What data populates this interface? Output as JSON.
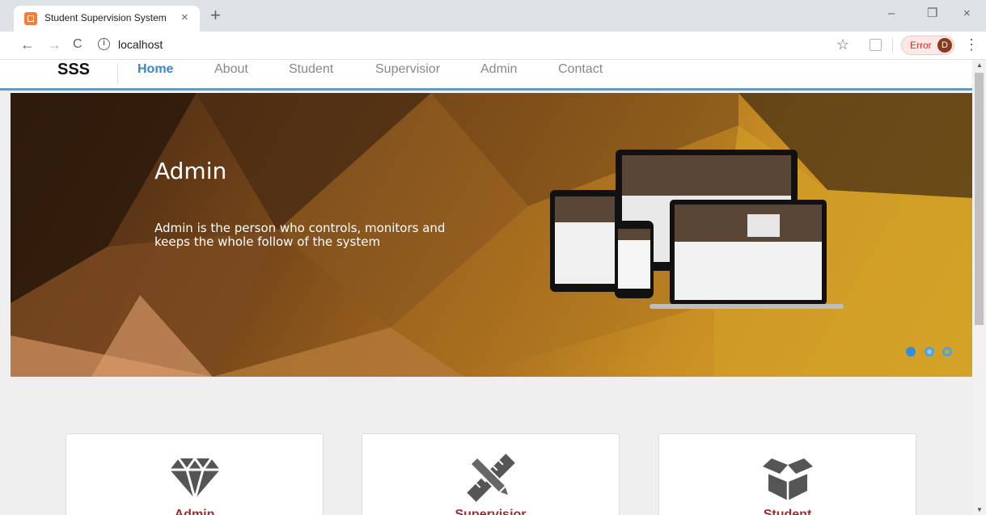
{
  "browser": {
    "tab_title": "Student Supervision System",
    "tab_close": "×",
    "new_tab": "+",
    "url": "localhost",
    "error_label": "Error",
    "profile_initial": "D",
    "window_controls": {
      "minimize": "–",
      "restore": "❐",
      "close": "×"
    },
    "nav": {
      "back": "←",
      "forward": "→",
      "reload": "C"
    },
    "info_glyph": "i",
    "star_glyph": "☆",
    "menu_glyph": "⋮"
  },
  "site": {
    "brand": "SSS",
    "nav": [
      {
        "label": "Home",
        "active": true
      },
      {
        "label": "About",
        "active": false
      },
      {
        "label": "Student",
        "active": false
      },
      {
        "label": "Supervisior",
        "active": false
      },
      {
        "label": "Admin",
        "active": false
      },
      {
        "label": "Contact",
        "active": false
      }
    ]
  },
  "hero": {
    "title": "Admin",
    "description": "Admin is the person who controls, monitors and keeps the whole follow of the system",
    "slides": 3,
    "active_slide": 0
  },
  "cards": [
    {
      "label": "Admin",
      "icon": "diamond-icon"
    },
    {
      "label": "Supervisior",
      "icon": "pencil-ruler-icon"
    },
    {
      "label": "Student",
      "icon": "box-icon"
    }
  ],
  "colors": {
    "accent": "#3a87c8",
    "nav_underline": "#4aa3df",
    "card_label": "#a32a2a",
    "error": "#d93025"
  }
}
